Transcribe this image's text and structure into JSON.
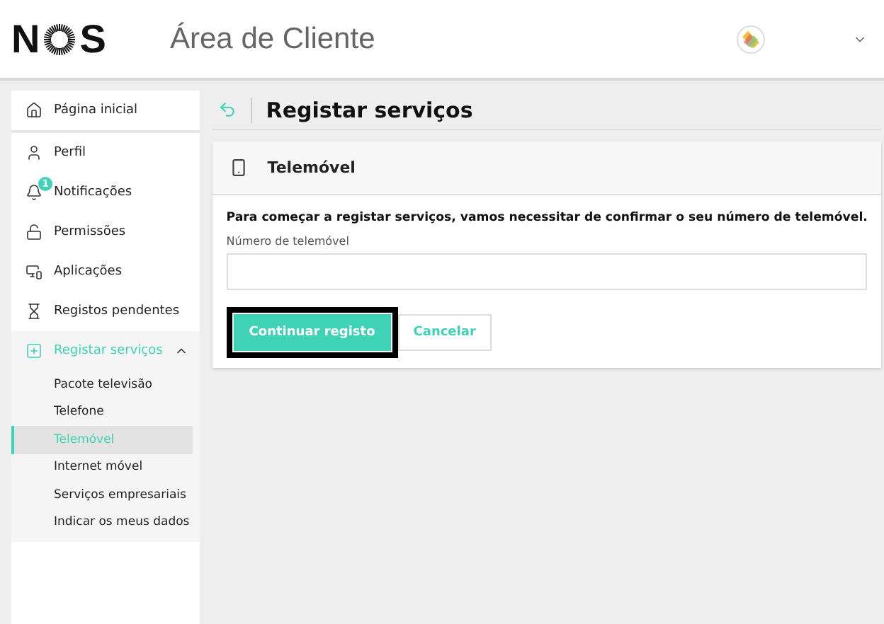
{
  "header": {
    "logo_letters": [
      "N",
      "S"
    ],
    "title": "Área de Cliente"
  },
  "sidebar": {
    "items": [
      {
        "label": "Página inicial",
        "selected": false
      },
      {
        "label": "Perfil",
        "selected": false
      },
      {
        "label": "Notificações",
        "badge": "1",
        "selected": false
      },
      {
        "label": "Permissões",
        "selected": false
      },
      {
        "label": "Aplicações",
        "selected": false
      },
      {
        "label": "Registos pendentes",
        "selected": false
      },
      {
        "label": "Registar serviços",
        "selected": true,
        "expanded": true,
        "children": [
          {
            "label": "Pacote televisão",
            "selected": false
          },
          {
            "label": "Telefone",
            "selected": false
          },
          {
            "label": "Telemóvel",
            "selected": true
          },
          {
            "label": "Internet móvel",
            "selected": false
          },
          {
            "label": "Serviços empresariais",
            "selected": false
          },
          {
            "label": "Indicar os meus dados",
            "selected": false
          }
        ]
      }
    ]
  },
  "page": {
    "title": "Registar serviços"
  },
  "card": {
    "title": "Telemóvel",
    "intro": "Para começar a registar serviços, vamos necessitar de confirmar o seu número de telemóvel.",
    "field_label": "Número de telemóvel",
    "buttons": [
      {
        "label": "Continuar registo",
        "kind": "primary",
        "focused": true
      },
      {
        "label": "Cancelar",
        "kind": "secondary",
        "focused": false
      }
    ]
  }
}
